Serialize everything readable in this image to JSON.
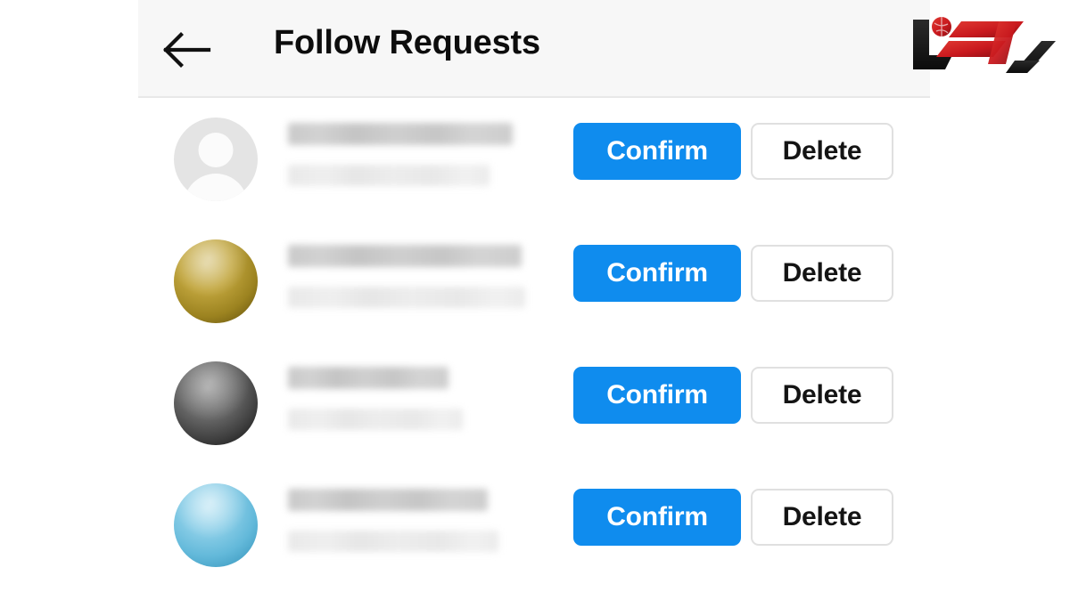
{
  "header": {
    "title": "Follow Requests",
    "back_icon": "arrow-left-icon",
    "background_color": "#f7f7f7"
  },
  "theme": {
    "confirm_button_color": "#0f8cee",
    "confirm_button_text_color": "#ffffff",
    "delete_button_border_color": "#e0e0e0",
    "delete_button_text_color": "#141414",
    "page_background": "#ffffff",
    "title_color": "#0d0d0d"
  },
  "actions": {
    "confirm_label": "Confirm",
    "delete_label": "Delete"
  },
  "requests": [
    {
      "avatar": {
        "type": "placeholder-person-icon",
        "color": "#e4e4e4"
      },
      "name_redacted": true,
      "name_bar_width": 252,
      "subtitle_bar_width": 226
    },
    {
      "avatar": {
        "type": "photo-sphere",
        "color": "#b89a2e"
      },
      "name_redacted": true,
      "name_bar_width": 262,
      "subtitle_bar_width": 266
    },
    {
      "avatar": {
        "type": "photo-sphere",
        "color": "#4a4a4a"
      },
      "name_redacted": true,
      "name_bar_width": 180,
      "subtitle_bar_width": 196
    },
    {
      "avatar": {
        "type": "photo-sphere",
        "color": "#74c2e0"
      },
      "name_redacted": true,
      "name_bar_width": 224,
      "subtitle_bar_width": 236
    }
  ],
  "watermark": {
    "name": "site-logo-watermark",
    "primary_color": "#c9191e",
    "secondary_color": "#1a1a1a"
  }
}
